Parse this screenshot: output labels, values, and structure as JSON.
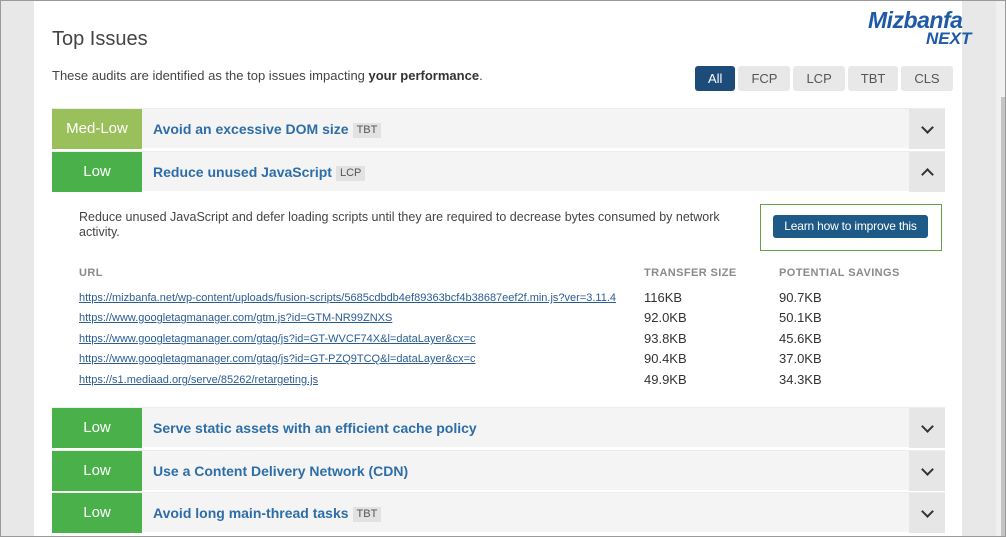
{
  "header": {
    "title": "Top Issues",
    "subtitle_prefix": "These audits are identified as the top issues impacting ",
    "subtitle_bold": "your performance",
    "subtitle_suffix": "."
  },
  "logo": {
    "main": "Mizbanfa",
    "sub": "NEXT",
    "color": "#1e5aa8"
  },
  "filters": [
    "All",
    "FCP",
    "LCP",
    "TBT",
    "CLS"
  ],
  "filters_active": "All",
  "issues": [
    {
      "badge": "Med-Low",
      "title": "Avoid an excessive DOM size",
      "tag": "TBT",
      "expanded": false
    },
    {
      "badge": "Low",
      "title": "Reduce unused JavaScript",
      "tag": "LCP",
      "expanded": true
    },
    {
      "badge": "Low",
      "title": "Serve static assets with an efficient cache policy",
      "tag": "",
      "expanded": false
    },
    {
      "badge": "Low",
      "title": "Use a Content Delivery Network (CDN)",
      "tag": "",
      "expanded": false
    },
    {
      "badge": "Low",
      "title": "Avoid long main-thread tasks",
      "tag": "TBT",
      "expanded": false
    }
  ],
  "detail": {
    "description": "Reduce unused JavaScript and defer loading scripts until they are required to decrease bytes consumed by network activity.",
    "learn_button": "Learn how to improve this",
    "columns": {
      "url": "URL",
      "transfer": "TRANSFER SIZE",
      "savings": "POTENTIAL SAVINGS"
    },
    "rows": [
      {
        "url": "https://mizbanfa.net/wp-content/uploads/fusion-scripts/5685cdbdb4ef89363bcf4b38687eef2f.min.js?ver=3.11.4",
        "transfer": "116KB",
        "savings": "90.7KB"
      },
      {
        "url": "https://www.googletagmanager.com/gtm.js?id=GTM-NR99ZNXS",
        "transfer": "92.0KB",
        "savings": "50.1KB"
      },
      {
        "url": "https://www.googletagmanager.com/gtag/js?id=GT-WVCF74X&l=dataLayer&cx=c",
        "transfer": "93.8KB",
        "savings": "45.6KB"
      },
      {
        "url": "https://www.googletagmanager.com/gtag/js?id=GT-PZQ9TCQ&l=dataLayer&cx=c",
        "transfer": "90.4KB",
        "savings": "37.0KB"
      },
      {
        "url": "https://s1.mediaad.org/serve/85262/retargeting.js",
        "transfer": "49.9KB",
        "savings": "34.3KB"
      }
    ]
  },
  "colors": {
    "medlow": "#9ac05c",
    "low": "#4ab04a",
    "accent": "#1e4c7a",
    "link": "#2d6ea8"
  }
}
